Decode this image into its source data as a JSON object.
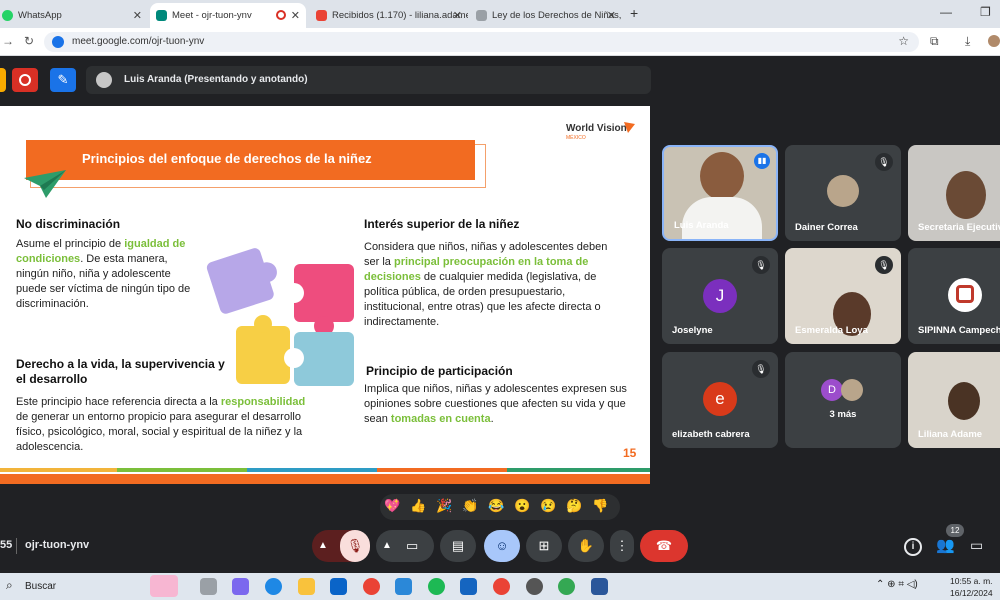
{
  "browser": {
    "tabs": [
      {
        "label": "WhatsApp",
        "color": "#25d366"
      },
      {
        "label": "Meet - ojr-tuon-ynv",
        "color": "#00897b"
      },
      {
        "label": "Recibidos (1.170) - liliana.adame",
        "color": "#ea4335"
      },
      {
        "label": "Ley de los Derechos de Niñas, N",
        "color": "#9aa0a6"
      }
    ],
    "new_tab": "+",
    "url": "meet.google.com/ojr-tuon-ynv"
  },
  "meet": {
    "presenter": "Luis Aranda (Presentando y anotando)",
    "meeting_code": "ojr-tuon-ynv",
    "time_prefix": "55",
    "participant_count": "12",
    "reactions": [
      "💖",
      "👍",
      "🎉",
      "👏",
      "😂",
      "😮",
      "😢",
      "🤔",
      "👎"
    ]
  },
  "slide": {
    "logo": "World Vision",
    "logo_sub": "MÉXICO",
    "title": "Principios del enfoque de derechos de la niñez",
    "s1_title": "No discriminación",
    "s1_a": "Asume el principio de ",
    "s1_b": "igualdad de condiciones",
    "s1_c": ". De esta manera, ningún niño, niña y adolescente puede ser víctima de ningún tipo de discriminación.",
    "s2_title": "Interés superior de la niñez",
    "s2_a": "Considera que niños, niñas y adolescentes deben ser la ",
    "s2_b": "principal preocupación en la toma de decisiones",
    "s2_c": " de cualquier medida (legislativa, de política pública, de orden presupuestario, institucional, entre otras) que les afecte directa o indirectamente.",
    "s3_title": "Derecho a la vida, la supervivencia y el desarrollo",
    "s3_a": "Este principio hace referencia directa a la ",
    "s3_b": "responsabilidad",
    "s3_c": " de generar un entorno propicio para asegurar el desarrollo físico, psicológico, moral, social y espiritual de la niñez y la adolescencia.",
    "s4_title": "Principio de participación",
    "s4_a": "Implica que niños, niñas y adolescentes expresen sus opiniones sobre cuestiones que afecten su vida y que sean ",
    "s4_b": "tomadas en cuenta",
    "s4_c": ".",
    "page": "15"
  },
  "participants": [
    {
      "name": "Luis Aranda",
      "initial": "",
      "color": "#c9c2b4"
    },
    {
      "name": "Dainer Correa",
      "initial": "",
      "color": "#3c4043"
    },
    {
      "name": "Secretaria Ejecutiv",
      "initial": "",
      "color": "#c9c7c3"
    },
    {
      "name": "Joselyne",
      "initial": "J",
      "color": "#7b2fbe"
    },
    {
      "name": "Esmeralda Loya",
      "initial": "",
      "color": "#ddd7cd"
    },
    {
      "name": "SIPINNA Campeche",
      "initial": "",
      "color": "#3c4043"
    },
    {
      "name": "elizabeth cabrera",
      "initial": "e",
      "color": "#d93a1a"
    },
    {
      "name": "3 más",
      "initial": "D",
      "color": "#9c4dcc"
    },
    {
      "name": "Liliana Adame",
      "initial": "",
      "color": "#d9d4cb"
    }
  ],
  "taskbar": {
    "search": "Buscar",
    "time": "10:55 a. m.",
    "date": "16/12/2024"
  }
}
